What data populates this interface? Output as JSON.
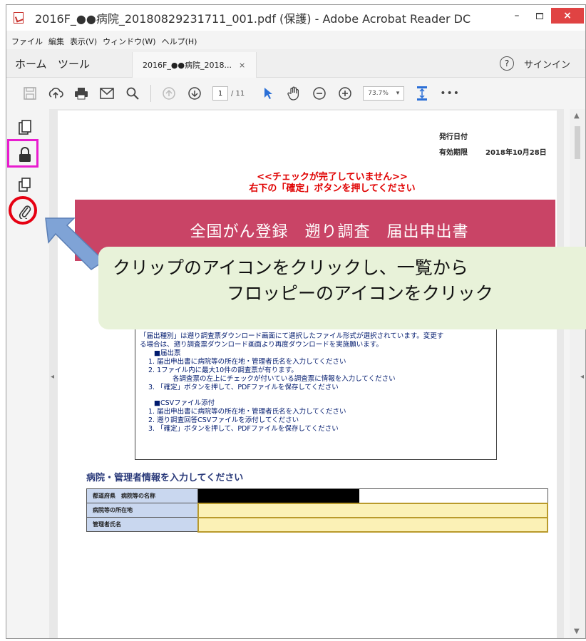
{
  "window": {
    "title": "2016F_●●病院_20180829231711_001.pdf (保護) - Adobe Acrobat Reader DC",
    "minimize_glyph": "–",
    "close_glyph": "×"
  },
  "menu": {
    "items": [
      "ファイル",
      "編集",
      "表示(V)",
      "ウィンドウ(W)",
      "ヘルプ(H)"
    ]
  },
  "tabs": {
    "home": "ホーム",
    "tools": "ツール",
    "document": "2016F_●●病院_2018...",
    "close": "×",
    "help": "?",
    "signin": "サインイン"
  },
  "toolbar": {
    "icons": [
      "save-icon",
      "upload-icon",
      "print-icon",
      "email-icon",
      "search-icon",
      "page-up-icon",
      "page-down-icon",
      "select-pointer-icon",
      "hand-icon",
      "zoom-out-icon",
      "zoom-in-icon",
      "fit-page-icon",
      "more-icon"
    ],
    "page_current": "1",
    "page_total": "/ 11",
    "zoom": "73.7%",
    "more": "•••"
  },
  "left_panel": {
    "icons": [
      "page-thumbnails-icon",
      "lock-icon",
      "layers-icon",
      "attachment-paperclip-icon"
    ]
  },
  "document": {
    "issue_label": "発行日付",
    "valid_label": "有効期限",
    "valid_date": "2018年10月28日",
    "warning_line1": "<<チェックが完了していません>>",
    "warning_line2": "右下の「確定」ボタンを押してください",
    "banner_title": "全国がん登録　遡り調査　届出申出書",
    "instructions": [
      "「届出種別」は遡り調査票ダウンロード画面にて選択したファイル形式が選択されています。変更す",
      "る場合は、遡り調査票ダウンロード画面より再度ダウンロードを実施願います。",
      "■届出票",
      "1. 届出申出書に病院等の所在地・管理者氏名を入力してください",
      "2. 1ファイル内に最大10件の調査票が有ります。",
      "各調査票の左上にチェックが付いている調査票に情報を入力してください",
      "3. 「確定」ボタンを押して、PDFファイルを保存してください",
      "",
      "■CSVファイル添付",
      "1. 届出申出書に病院等の所在地・管理者氏名を入力してください",
      "2. 遡り調査回答CSVファイルを添付してください",
      "3. 「確定」ボタンを押して、PDFファイルを保存してください"
    ],
    "section_title": "病院・管理者情報を入力してください",
    "form_rows": [
      {
        "label": "都道府県　病院等の名称"
      },
      {
        "label": "病院等の所在地"
      },
      {
        "label": "管理者氏名"
      }
    ]
  },
  "annotation": {
    "line1": "クリップのアイコンをクリックし、一覧から",
    "line2": "フロッピーのアイコンをクリック",
    "callout_color": "#e8f2d9",
    "arrow_color": "#7fa3d6",
    "highlight_magenta": "#e81ccf",
    "highlight_red": "#e60012"
  }
}
